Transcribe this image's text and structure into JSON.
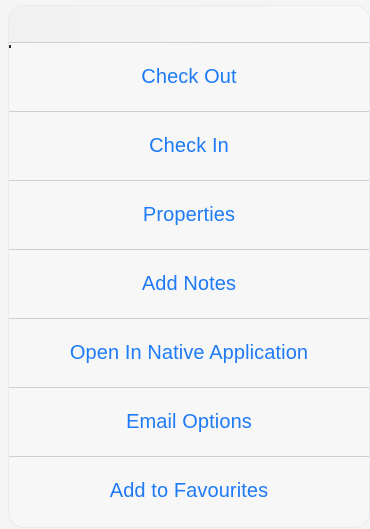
{
  "menu": {
    "items": [
      {
        "label": "Check Out"
      },
      {
        "label": "Check In"
      },
      {
        "label": "Properties"
      },
      {
        "label": "Add Notes"
      },
      {
        "label": "Open In Native Application"
      },
      {
        "label": "Email Options"
      },
      {
        "label": "Add to Favourites"
      }
    ]
  },
  "colors": {
    "accent": "#1e7bf5",
    "separator": "#cfcfd3",
    "background": "#f7f7f8"
  }
}
